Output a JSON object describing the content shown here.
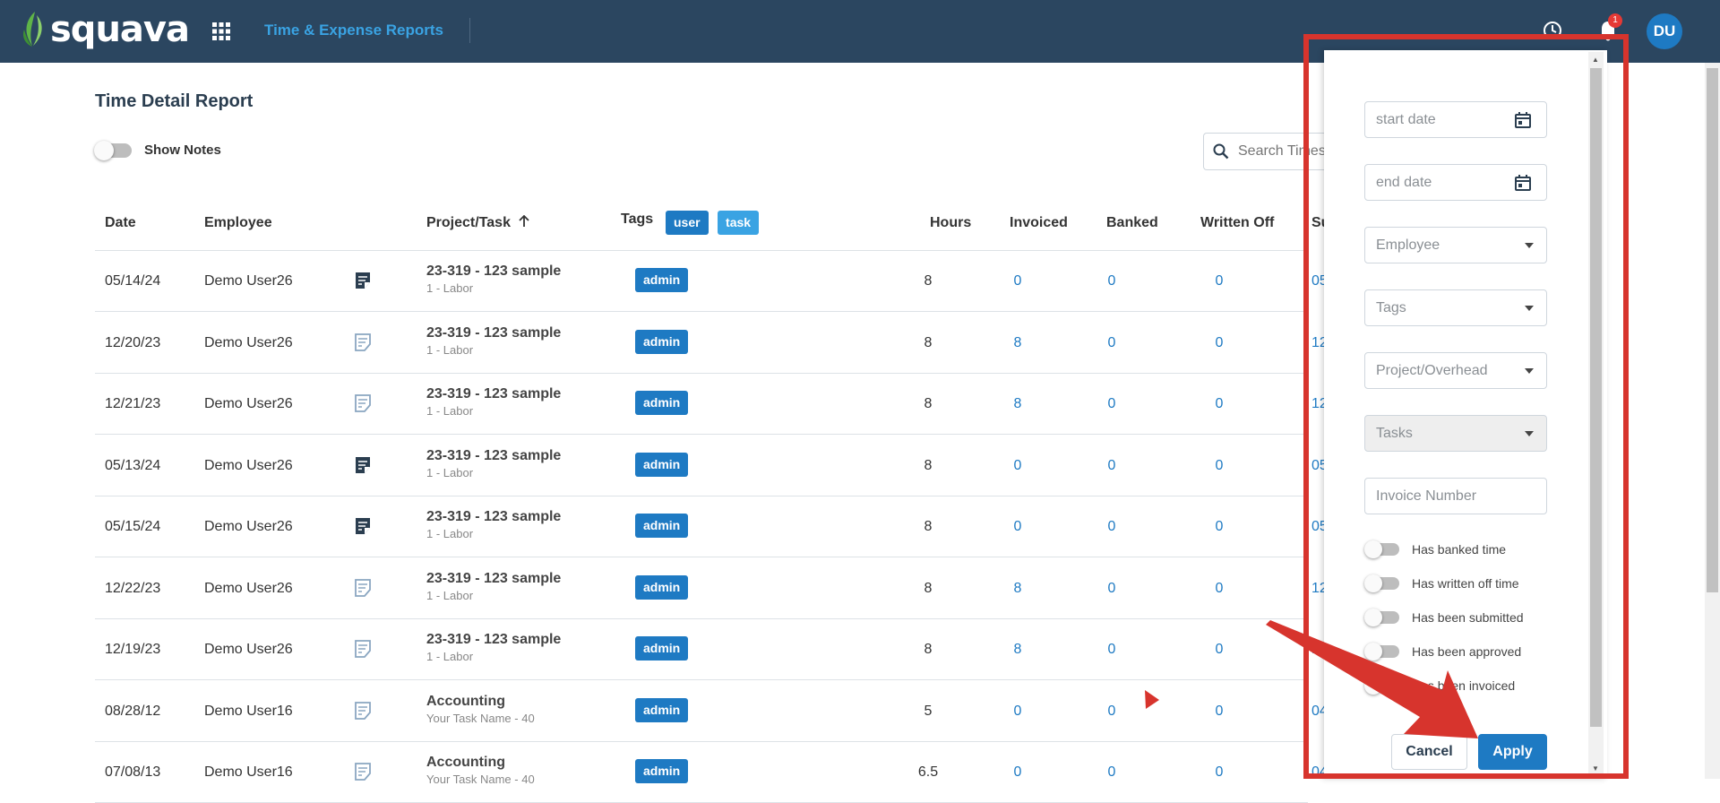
{
  "header": {
    "brand": "squava",
    "nav_title": "Time & Expense Reports",
    "notification_count": "1",
    "avatar_initials": "DU"
  },
  "page": {
    "title": "Time Detail Report",
    "show_notes_label": "Show Notes",
    "search_placeholder": "Search Times"
  },
  "table": {
    "headers": {
      "date": "Date",
      "employee": "Employee",
      "project": "Project/Task",
      "tags": "Tags",
      "hours": "Hours",
      "invoiced": "Invoiced",
      "banked": "Banked",
      "written_off": "Written Off",
      "submitted": "Su"
    },
    "tag_filters": [
      "user",
      "task"
    ],
    "rows": [
      {
        "date": "05/14/24",
        "employee": "Demo User26",
        "note": "filled",
        "project": "23-319 - 123 sample",
        "task": "1 - Labor",
        "tag": "admin",
        "hours": "8",
        "invoiced": "0",
        "banked": "0",
        "written_off": "0",
        "submitted": "05"
      },
      {
        "date": "12/20/23",
        "employee": "Demo User26",
        "note": "outline",
        "project": "23-319 - 123 sample",
        "task": "1 - Labor",
        "tag": "admin",
        "hours": "8",
        "invoiced": "8",
        "banked": "0",
        "written_off": "0",
        "submitted": "12"
      },
      {
        "date": "12/21/23",
        "employee": "Demo User26",
        "note": "outline",
        "project": "23-319 - 123 sample",
        "task": "1 - Labor",
        "tag": "admin",
        "hours": "8",
        "invoiced": "8",
        "banked": "0",
        "written_off": "0",
        "submitted": "12"
      },
      {
        "date": "05/13/24",
        "employee": "Demo User26",
        "note": "filled",
        "project": "23-319 - 123 sample",
        "task": "1 - Labor",
        "tag": "admin",
        "hours": "8",
        "invoiced": "0",
        "banked": "0",
        "written_off": "0",
        "submitted": "05"
      },
      {
        "date": "05/15/24",
        "employee": "Demo User26",
        "note": "filled",
        "project": "23-319 - 123 sample",
        "task": "1 - Labor",
        "tag": "admin",
        "hours": "8",
        "invoiced": "0",
        "banked": "0",
        "written_off": "0",
        "submitted": "05"
      },
      {
        "date": "12/22/23",
        "employee": "Demo User26",
        "note": "outline",
        "project": "23-319 - 123 sample",
        "task": "1 - Labor",
        "tag": "admin",
        "hours": "8",
        "invoiced": "8",
        "banked": "0",
        "written_off": "0",
        "submitted": "12"
      },
      {
        "date": "12/19/23",
        "employee": "Demo User26",
        "note": "outline",
        "project": "23-319 - 123 sample",
        "task": "1 - Labor",
        "tag": "admin",
        "hours": "8",
        "invoiced": "8",
        "banked": "0",
        "written_off": "0",
        "submitted": "1"
      },
      {
        "date": "08/28/12",
        "employee": "Demo User16",
        "note": "outline",
        "project": "Accounting",
        "task": "Your Task Name - 40",
        "tag": "admin",
        "hours": "5",
        "invoiced": "0",
        "banked": "0",
        "written_off": "0",
        "submitted": "04"
      },
      {
        "date": "07/08/13",
        "employee": "Demo User16",
        "note": "outline",
        "project": "Accounting",
        "task": "Your Task Name - 40",
        "tag": "admin",
        "hours": "6.5",
        "invoiced": "0",
        "banked": "0",
        "written_off": "0",
        "submitted": "04"
      }
    ]
  },
  "filter_panel": {
    "start_date_placeholder": "start date",
    "end_date_placeholder": "end date",
    "employee_placeholder": "Employee",
    "tags_placeholder": "Tags",
    "project_placeholder": "Project/Overhead",
    "tasks_placeholder": "Tasks",
    "invoice_placeholder": "Invoice Number",
    "switches": [
      "Has banked time",
      "Has written off time",
      "Has been submitted",
      "Has been approved",
      "Has been invoiced"
    ],
    "cancel_label": "Cancel",
    "apply_label": "Apply"
  },
  "colors": {
    "header_bg": "#2b4660",
    "accent": "#1e7ac3",
    "link": "#3aa3e3",
    "annotation": "#d7342d"
  }
}
